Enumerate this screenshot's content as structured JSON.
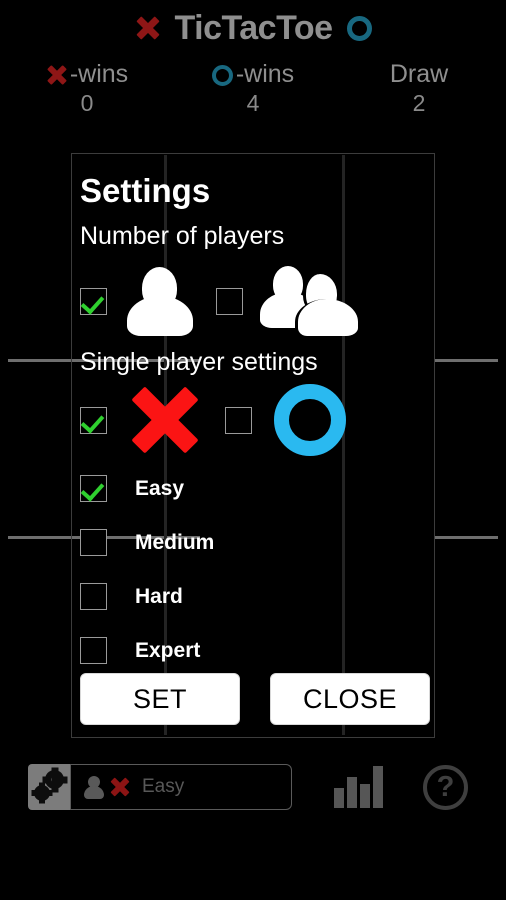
{
  "app": {
    "title": "TicTacToe",
    "x_icon": "x-mark-icon",
    "o_icon": "o-mark-icon"
  },
  "scoreboard": [
    {
      "label": "-wins",
      "icon": "x-mark-icon",
      "value": "0"
    },
    {
      "label": "-wins",
      "icon": "o-mark-icon",
      "value": "4"
    },
    {
      "label": "Draw",
      "icon": "none",
      "value": "2"
    }
  ],
  "dialog": {
    "title": "Settings",
    "sections": [
      {
        "label": "Number of players"
      },
      {
        "label": "Single player settings"
      }
    ],
    "player_options": [
      {
        "name": "one-player",
        "icon": "single-person-icon",
        "checked": true
      },
      {
        "name": "two-players",
        "icon": "two-person-icon",
        "checked": false
      }
    ],
    "mark_options": [
      {
        "name": "play-as-x",
        "icon": "x-mark-icon",
        "checked": true
      },
      {
        "name": "play-as-o",
        "icon": "o-mark-icon",
        "checked": false
      }
    ],
    "difficulties": [
      {
        "label": "Easy",
        "checked": true
      },
      {
        "label": "Medium",
        "checked": false
      },
      {
        "label": "Hard",
        "checked": false
      },
      {
        "label": "Expert",
        "checked": false
      }
    ],
    "buttons": {
      "set_label": "SET",
      "close_label": "CLOSE"
    }
  },
  "bottom_bar": {
    "settings_icon": "gears-icon",
    "status": {
      "person_icon": "person-icon",
      "mark_icon": "x-mark-icon",
      "text": "Easy"
    },
    "stats_icon": "bar-chart-icon",
    "help_icon": "question-mark-icon",
    "help_glyph": "?"
  },
  "colors": {
    "x_red": "#fb1414",
    "o_blue": "#2ab9f0",
    "check_green": "#2fd02f",
    "header_gray": "#8f8f8f",
    "background": "#000000"
  }
}
